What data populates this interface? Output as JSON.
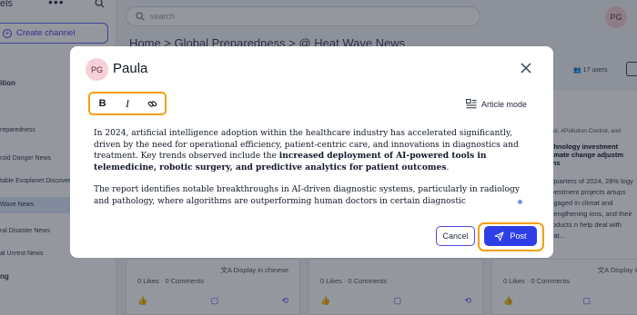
{
  "sidebar": {
    "header_label": "els",
    "create_label": "Create channel",
    "items": [
      {
        "label": "ition",
        "bold": true
      },
      {
        "label": "reparedness",
        "bold": false
      },
      {
        "label": "roid Danger News",
        "bold": false
      },
      {
        "label": "table Exoplanet Discoveri",
        "bold": false
      },
      {
        "label": "Wave News",
        "bold": false
      },
      {
        "label": "ral Disaster News",
        "bold": false
      },
      {
        "label": "al Unrest News",
        "bold": false
      },
      {
        "label": "ng",
        "bold": true
      }
    ]
  },
  "topbar": {
    "search_placeholder": "search",
    "avatar_initials": "PG"
  },
  "breadcrumb": {
    "text": "Home  >  Global Preparedness  >  @  Heat Wave News"
  },
  "right_panel": {
    "users": "17 users",
    "tags": "ntrol, #Pollution Control, and",
    "title": "echnology investment climate change adjustm ions",
    "body": "e quarters of 2024, 28% logy investment projects artups engaged in climat and strengthening ions, and their products n help deal with heat..."
  },
  "cards": [
    {
      "translate": "Display in chinese",
      "likes": "0 Likes",
      "comments": "0 Comments"
    },
    {
      "translate": "",
      "likes": "0 Likes",
      "comments": "0 Comments"
    },
    {
      "translate": "Display in chi",
      "likes": "0 Likes",
      "comments": "0 Comments"
    }
  ],
  "modal": {
    "avatar_initials": "PG",
    "user_name": "Paula",
    "article_mode_label": "Article mode",
    "paragraph1_start": "In 2024, artificial intelligence adoption within the healthcare industry has accelerated significantly, driven by the need for operational efficiency, patient-centric care, and innovations in diagnostics and treatment. Key trends observed include the ",
    "paragraph1_bold": "increased deployment of AI-powered tools in telemedicine, robotic surgery, and predictive analytics for patient outcomes",
    "paragraph1_end": ".",
    "paragraph2": "The report identifies notable breakthroughs in AI-driven diagnostic systems, particularly in radiology and pathology, where algorithms are outperforming human doctors in certain diagnostic",
    "cancel_label": "Cancel",
    "post_label": "Post"
  },
  "colors": {
    "accent": "#2e3ee6",
    "highlight": "#f59e0b",
    "avatar_bg": "#f5d0d8"
  }
}
